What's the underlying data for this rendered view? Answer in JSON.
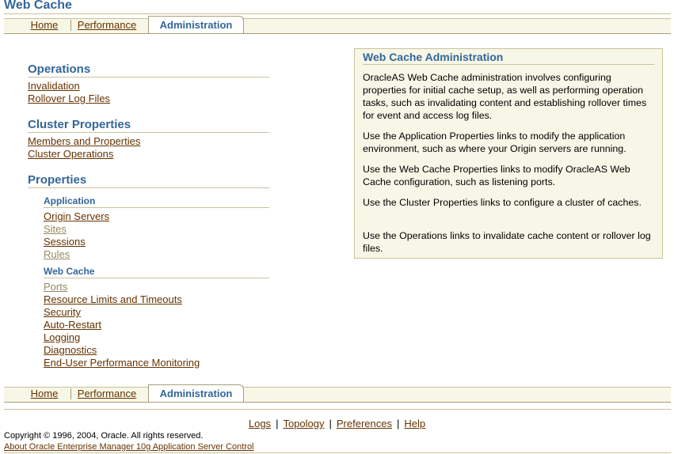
{
  "app_title": "Web Cache",
  "tabs": {
    "home": "Home",
    "performance": "Performance",
    "administration": "Administration"
  },
  "operations": {
    "heading": "Operations",
    "links": [
      "Invalidation",
      "Rollover Log Files"
    ]
  },
  "cluster_properties": {
    "heading": "Cluster Properties",
    "links": [
      "Members and Properties",
      "Cluster Operations"
    ]
  },
  "properties": {
    "heading": "Properties",
    "application": {
      "heading": "Application",
      "links": [
        "Origin Servers",
        "Sites",
        "Sessions",
        "Rules"
      ]
    },
    "web_cache": {
      "heading": "Web Cache",
      "links": [
        "Ports",
        "Resource Limits and Timeouts",
        "Security",
        "Auto-Restart",
        "Logging",
        "Diagnostics",
        "End-User Performance Monitoring"
      ]
    }
  },
  "info_box": {
    "title": "Web Cache Administration",
    "paragraphs": [
      "OracleAS Web Cache administration involves configuring properties for initial cache setup, as well as performing operation tasks, such as invalidating content and establishing rollover times for event and access log files.",
      "Use the Application Properties links to modify the application environment, such as where your Origin servers are running.",
      "Use the Web Cache Properties links to modify OracleAS Web Cache configuration, such as listening ports.",
      "Use the Cluster Properties links to configure a cluster of caches.",
      "Use the Operations links to invalidate cache content or rollover log files."
    ]
  },
  "footer": {
    "links": [
      "Logs",
      "Topology",
      "Preferences",
      "Help"
    ],
    "separator": "|",
    "copyright": "Copyright © 1996, 2004, Oracle. All rights reserved.",
    "about_link": "About Oracle Enterprise Manager 10g Application Server Control"
  },
  "colors": {
    "heading_blue": "#336699",
    "link_brown": "#663300",
    "link_dim": "#998866",
    "panel_beige": "#f7f7e7",
    "rule_tan": "#c9c29a"
  }
}
